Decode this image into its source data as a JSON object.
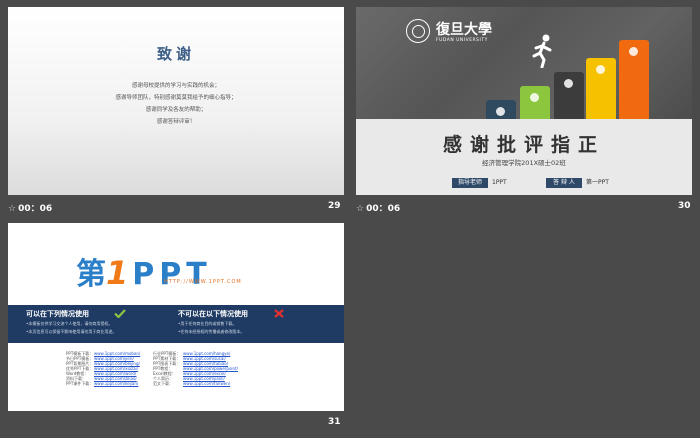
{
  "slides": [
    {
      "number": "29",
      "duration": "00：06",
      "title": "致谢",
      "lines": [
        "感谢母校提供的学习与实践的机会；",
        "感谢导师团队，特别感谢莫莫我给予的细心指导；",
        "感谢同学及各友的帮助；",
        "感谢答辩评审！"
      ]
    },
    {
      "number": "30",
      "duration": "00：06",
      "university_cn": "復旦大學",
      "university_en": "FUDAN UNIVERSITY",
      "title": "感谢批评指正",
      "subtitle": "经济管理学院201X硕士02班",
      "advisor_label": "指导老师",
      "advisor_value": "1PPT",
      "presenter_label": "答 辩 人",
      "presenter_value": "第一PPT",
      "bar_colors": [
        "#2f4a5e",
        "#8cc63f",
        "#3c3c3c",
        "#f6c200",
        "#f26a10"
      ]
    },
    {
      "number": "31",
      "logo_text_1": "第",
      "logo_text_2": "1",
      "logo_text_3": "PPT",
      "logo_url": "HTTP://WWW.1PPT.COM",
      "can_use_heading": "可以在下列情况使用",
      "can_use_lines": [
        "•本模板仅供学习交流个人使用，请勿商用侵权。",
        "•本页信息可以保留不影响使用请勿用于商业用途。"
      ],
      "cannot_use_heading": "不可以在以下情况使用",
      "cannot_use_lines": [
        "•用于任何商业目的或销售下载。",
        "•任何未经授权的传播或者修改版本。"
      ],
      "links_left_labels": [
        "PPT模板下载：",
        "节日PPT模板：",
        "PPT背景图片：",
        "优秀PPT下载：",
        "Word教程：",
        "资料下载：",
        "PPT课件下载："
      ],
      "links_left_urls": [
        "www.1ppt.com/moban/",
        "www.1ppt.com/jieri/",
        "www.1ppt.com/beijing/",
        "www.1ppt.com/xiazai/",
        "www.1ppt.com/word/",
        "www.1ppt.com/ziliao/",
        "www.1ppt.com/kejian/"
      ],
      "links_right_labels": [
        "行业PPT模板：",
        "PPT素材下载：",
        "PPT图表下载：",
        "PPT教程：",
        "Excel教程：",
        "个人简历：",
        "范文下载："
      ],
      "links_right_urls": [
        "www.1ppt.com/hangye/",
        "www.1ppt.com/sucai/",
        "www.1ppt.com/tubiao/",
        "www.1ppt.com/powerpoint/",
        "www.1ppt.com/excel/",
        "www.1ppt.com/jianli/",
        "www.1ppt.com/fanwen/"
      ]
    }
  ]
}
